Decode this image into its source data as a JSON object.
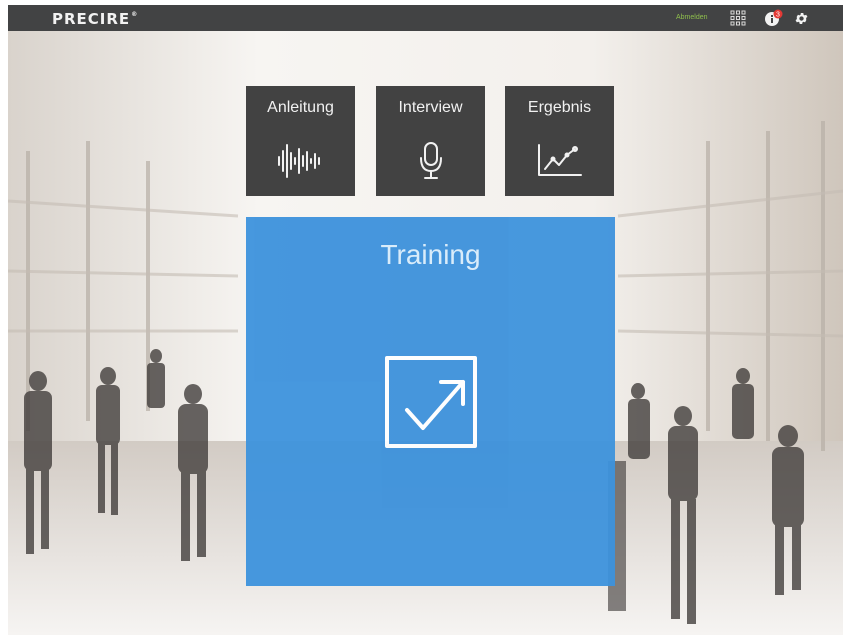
{
  "topbar": {
    "logo_text": "PRECIRE",
    "logo_mark": "®",
    "logout_label": "Abmelden",
    "notification_count": "3",
    "icons": [
      "apps-grid-icon",
      "info-icon",
      "gear-icon"
    ]
  },
  "tiles": [
    {
      "label": "Anleitung",
      "icon": "audio-wave-icon"
    },
    {
      "label": "Interview",
      "icon": "microphone-icon"
    },
    {
      "label": "Ergebnis",
      "icon": "line-chart-icon"
    }
  ],
  "training": {
    "label": "Training",
    "icon": "open-external-icon"
  },
  "colors": {
    "topbar": "#424344",
    "tile": "#424242",
    "accent": "#3d92dc",
    "logout": "#8fbf4d",
    "badge": "#e53935"
  }
}
